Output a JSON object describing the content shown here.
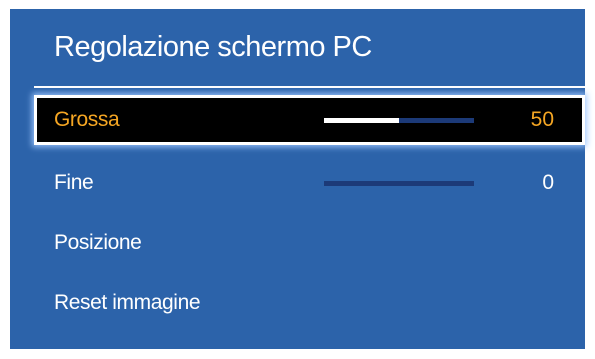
{
  "menu": {
    "title": "Regolazione schermo PC",
    "items": [
      {
        "label": "Grossa",
        "value": "50",
        "slider_level": 0.5,
        "selected": true
      },
      {
        "label": "Fine",
        "value": "0",
        "slider_level": 0,
        "selected": false
      },
      {
        "label": "Posizione"
      },
      {
        "label": "Reset immagine"
      }
    ]
  },
  "colors": {
    "panel_background": "#2c63aa",
    "selected_text": "#f5a623",
    "slider_track": "#1c3a78",
    "slider_fill": "#ffffff"
  }
}
